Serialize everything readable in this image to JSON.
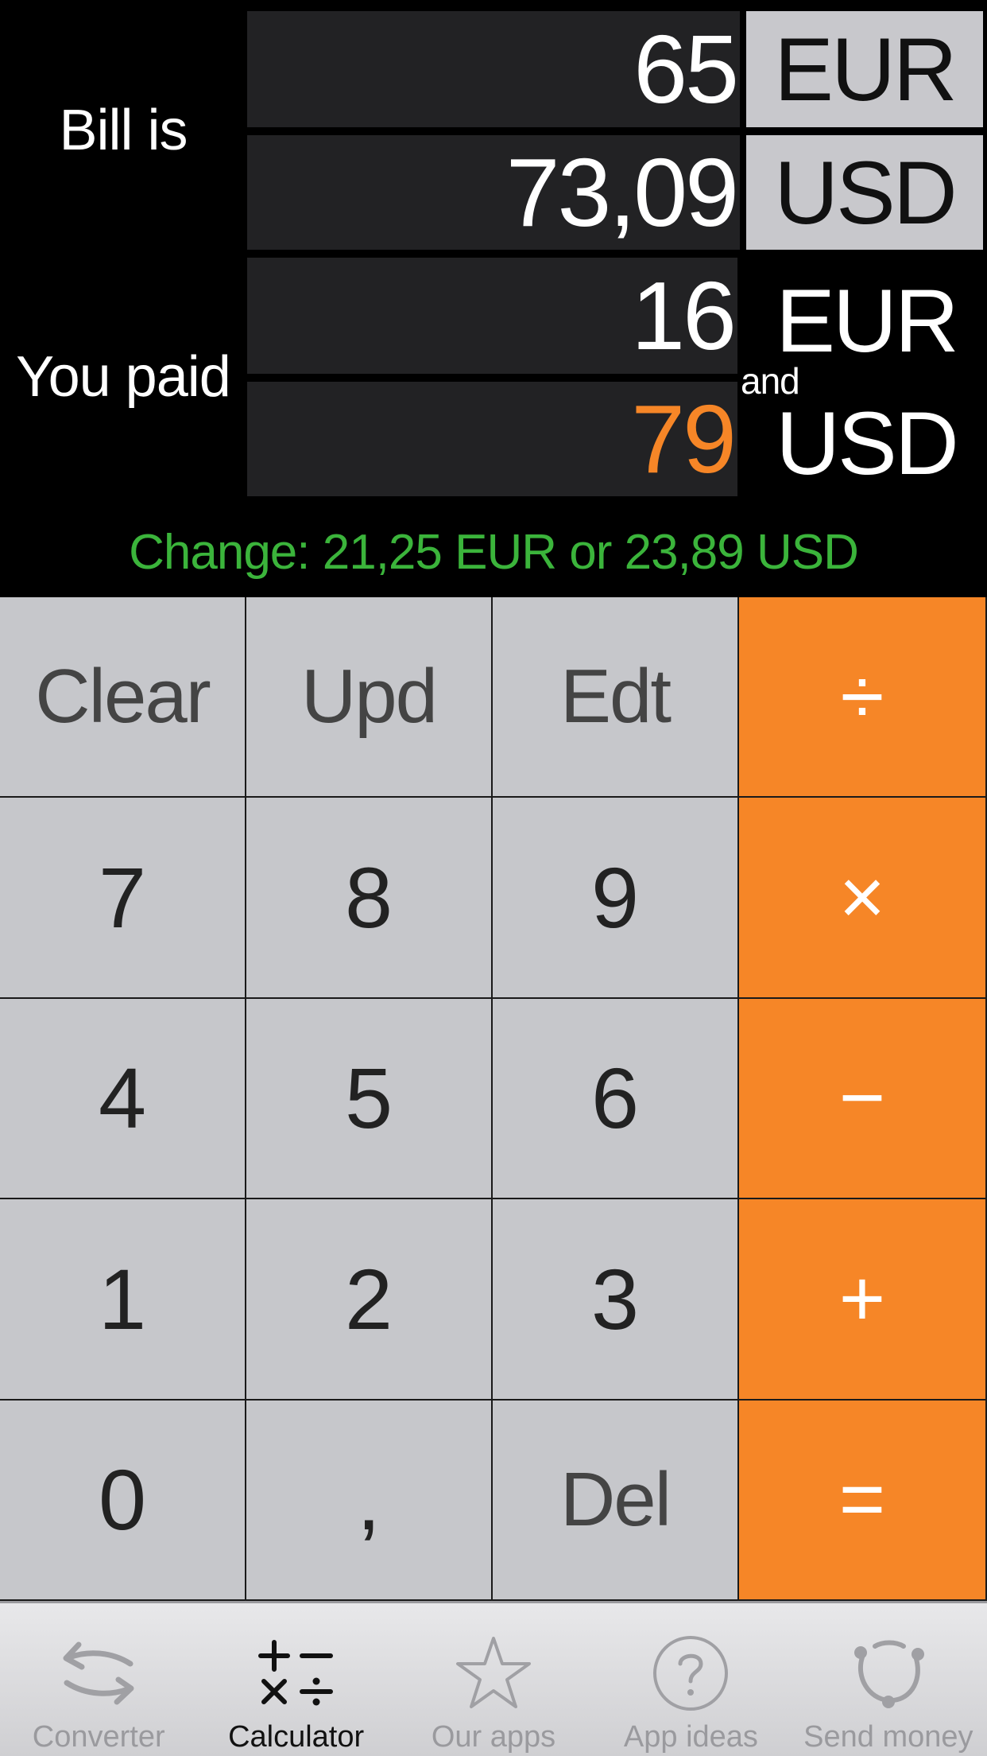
{
  "header": {
    "bill_label": "Bill is",
    "paid_label": "You paid",
    "and_label": "and"
  },
  "bill": {
    "amount_eur": "65",
    "currency_eur": "EUR",
    "amount_usd": "73,09",
    "currency_usd": "USD"
  },
  "paid": {
    "amount_eur": "16",
    "currency_eur": "EUR",
    "amount_usd": "79",
    "currency_usd": "USD"
  },
  "change_text": "Change: 21,25 EUR or 23,89 USD",
  "keypad": {
    "clear": "Clear",
    "update": "Upd",
    "edit": "Edt",
    "divide": "÷",
    "seven": "7",
    "eight": "8",
    "nine": "9",
    "multiply": "×",
    "four": "4",
    "five": "5",
    "six": "6",
    "minus": "−",
    "one": "1",
    "two": "2",
    "three": "3",
    "plus": "+",
    "zero": "0",
    "comma": ",",
    "delete": "Del",
    "equals": "="
  },
  "tabs": [
    {
      "label": "Converter",
      "icon": "converter-arrows-icon",
      "selected": false
    },
    {
      "label": "Calculator",
      "icon": "calculator-operators-icon",
      "selected": true
    },
    {
      "label": "Our apps",
      "icon": "star-icon",
      "selected": false
    },
    {
      "label": "App ideas",
      "icon": "question-circle-icon",
      "selected": false
    },
    {
      "label": "Send money",
      "icon": "send-money-icon",
      "selected": false
    }
  ],
  "colors": {
    "accent_orange": "#f68627",
    "change_green": "#3bb43b",
    "key_gray": "#c6c7cb",
    "field_dark": "#222224"
  }
}
